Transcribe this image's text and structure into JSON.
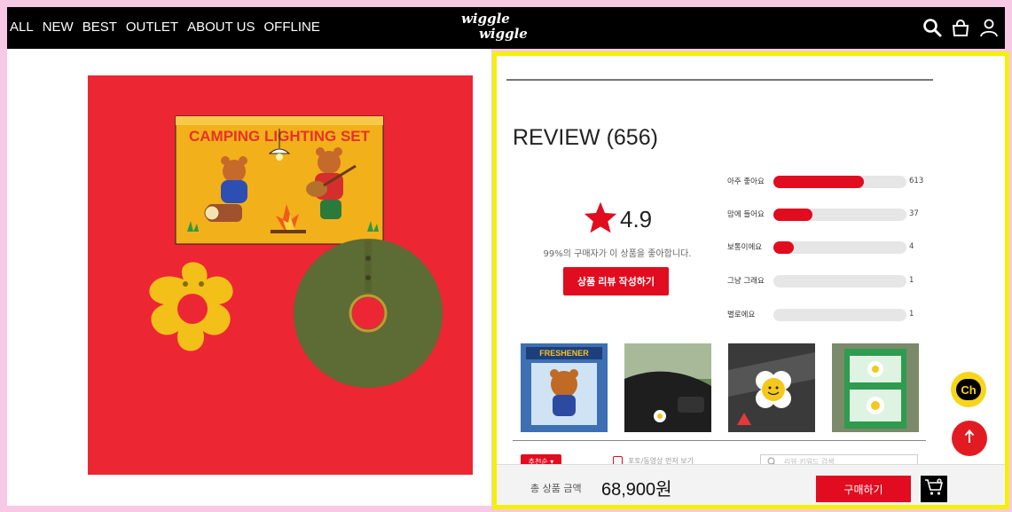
{
  "nav": {
    "items": [
      "ALL",
      "NEW",
      "BEST",
      "OUTLET",
      "ABOUT US",
      "OFFLINE"
    ],
    "logo_line1": "wiggle",
    "logo_line2": "wiggle"
  },
  "product": {
    "box_title": "CAMPING LIGHTING SET"
  },
  "review": {
    "title": "REVIEW (656)",
    "score": "4.9",
    "like_text": "99%의 구매자가 이 상품을 좋아합니다.",
    "write_button": "상품 리뷰 작성하기",
    "ratings": [
      {
        "label": "아주 좋아요",
        "count": "613",
        "fraction": 0.68
      },
      {
        "label": "맘에 들어요",
        "count": "37",
        "fraction": 0.29
      },
      {
        "label": "보통이에요",
        "count": "4",
        "fraction": 0.15
      },
      {
        "label": "그냥 그래요",
        "count": "1",
        "fraction": 0
      },
      {
        "label": "별로에요",
        "count": "1",
        "fraction": 0
      }
    ],
    "photo_box_text": "FRESHENER",
    "sort_label": "추천순 ▾",
    "photo_filter_label": "포토/동영상 먼저 보기",
    "search_placeholder": "리뷰 키워드 검색"
  },
  "purchase": {
    "total_label": "총 상품 금액",
    "total_price": "68,900원",
    "buy_button": "구매하기"
  },
  "floating": {
    "channel_label": "Ch"
  },
  "colors": {
    "accent": "#e10c1f",
    "highlight_border": "#f4f00a",
    "background": "#f7c9e4"
  }
}
